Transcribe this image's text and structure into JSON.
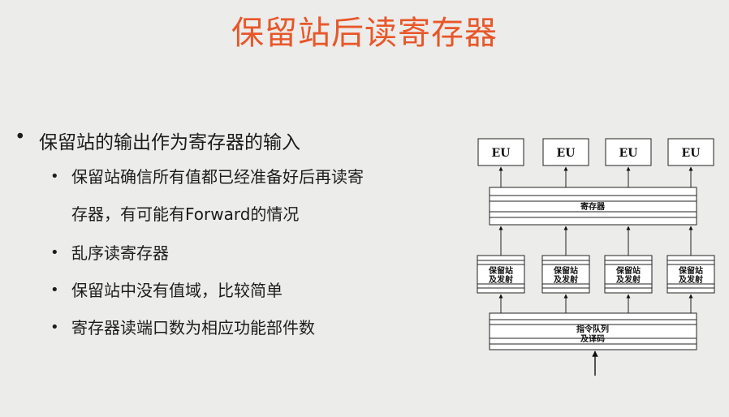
{
  "slide": {
    "title": "保留站后读寄存器",
    "bullet_level1": "保留站的输出作为寄存器的输入",
    "bullets_level2": [
      {
        "text": "保留站确信所有值都已经准备好后再读寄",
        "cont": "存器，有可能有Forward的情况"
      },
      {
        "text": "乱序读寄存器"
      },
      {
        "text": "保留站中没有值域，比较简单"
      },
      {
        "text": "寄存器读端口数为相应功能部件数"
      }
    ],
    "bullet_symbol": "•",
    "title_color": "#e8572a"
  },
  "diagram": {
    "eu_labels": [
      "EU",
      "EU",
      "EU",
      "EU"
    ],
    "register_label": "寄存器",
    "rs_labels": [
      {
        "line1": "保留站",
        "line2": "及发射"
      },
      {
        "line1": "保留站",
        "line2": "及发射"
      },
      {
        "line1": "保留站",
        "line2": "及发射"
      },
      {
        "line1": "保留站",
        "line2": "及发射"
      }
    ],
    "queue_label_line1": "指令队列",
    "queue_label_line2": "及译码"
  }
}
